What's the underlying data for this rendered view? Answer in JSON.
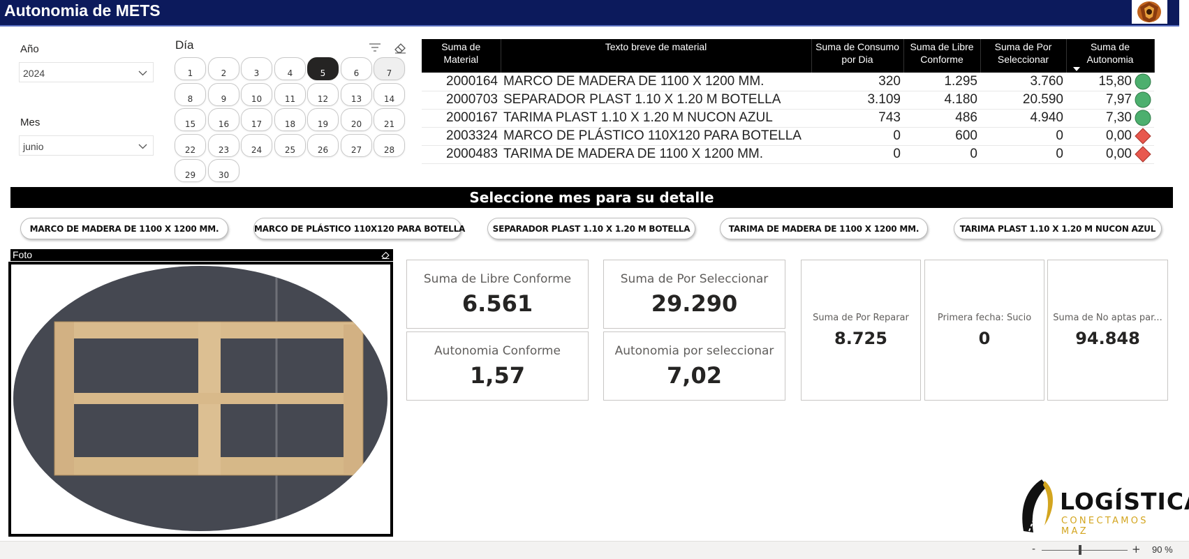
{
  "header": {
    "title": "Autonomia de METS"
  },
  "filters": {
    "year": {
      "label": "Año",
      "value": "2024"
    },
    "month": {
      "label": "Mes",
      "value": "junio"
    },
    "day": {
      "label": "Día",
      "days": [
        "1",
        "2",
        "3",
        "4",
        "5",
        "6",
        "7",
        "8",
        "9",
        "10",
        "11",
        "12",
        "13",
        "14",
        "15",
        "16",
        "17",
        "18",
        "19",
        "20",
        "21",
        "22",
        "23",
        "24",
        "25",
        "26",
        "27",
        "28",
        "29",
        "30"
      ],
      "selected": "5"
    }
  },
  "table": {
    "headers": [
      "Suma de Material",
      "Texto breve de material",
      "Suma de Consumo por Dia",
      "Suma de Libre Conforme",
      "Suma de Por Seleccionar",
      "Suma de Autonomia"
    ],
    "rows": [
      {
        "material": "2000164",
        "texto": "MARCO DE MADERA DE 1100 X 1200 MM.",
        "consumo": "320",
        "libre": "1.295",
        "por_sel": "3.760",
        "autonomia": "15,80",
        "status": "green-circle"
      },
      {
        "material": "2000703",
        "texto": "SEPARADOR PLAST 1.10 X 1.20 M BOTELLA",
        "consumo": "3.109",
        "libre": "4.180",
        "por_sel": "20.590",
        "autonomia": "7,97",
        "status": "green-circle"
      },
      {
        "material": "2000167",
        "texto": "TARIMA PLAST 1.10 X 1.20 M NUCON AZUL",
        "consumo": "743",
        "libre": "486",
        "por_sel": "4.940",
        "autonomia": "7,30",
        "status": "green-circle"
      },
      {
        "material": "2003324",
        "texto": "MARCO DE PLÁSTICO 110X120 PARA BOTELLA",
        "consumo": "0",
        "libre": "600",
        "por_sel": "0",
        "autonomia": "0,00",
        "status": "red-diamond"
      },
      {
        "material": "2000483",
        "texto": "TARIMA DE MADERA DE 1100 X 1200 MM.",
        "consumo": "0",
        "libre": "0",
        "por_sel": "0",
        "autonomia": "0,00",
        "status": "red-diamond"
      }
    ]
  },
  "banner": {
    "text": "Seleccione mes para su detalle"
  },
  "material_buttons": [
    "MARCO DE MADERA DE 1100 X 1200 MM.",
    "MARCO DE PLÁSTICO 110X120 PARA BOTELLA",
    "SEPARADOR PLAST 1.10 X 1.20 M BOTELLA",
    "TARIMA DE MADERA DE 1100 X 1200 MM.",
    "TARIMA PLAST 1.10 X 1.20 M NUCON AZUL"
  ],
  "foto": {
    "label": "Foto"
  },
  "cards": {
    "libre_conforme": {
      "label": "Suma de Libre Conforme",
      "value": "6.561"
    },
    "por_seleccionar": {
      "label": "Suma de Por Seleccionar",
      "value": "29.290"
    },
    "autonomia_conforme": {
      "label": "Autonomia Conforme",
      "value": "1,57"
    },
    "autonomia_por_sel": {
      "label": "Autonomia por seleccionar",
      "value": "7,02"
    },
    "por_reparar": {
      "label": "Suma de Por Reparar",
      "value": "8.725"
    },
    "primera_fecha": {
      "label": "Primera fecha: Sucio",
      "value": "0"
    },
    "no_aptas": {
      "label": "Suma de No aptas par...",
      "value": "94.848"
    }
  },
  "logo": {
    "name": "LOGÍSTICA",
    "tagline": "CONECTAMOS MAZ"
  },
  "status_bar": {
    "zoom_minus": "-",
    "zoom_plus": "+",
    "zoom": "90 %",
    "zoom_level": 0.5
  },
  "colors": {
    "header_bg": "#0c1a5c",
    "green": "#4caf6e",
    "red": "#e8584e",
    "logo_gold": "#d3a51f"
  }
}
